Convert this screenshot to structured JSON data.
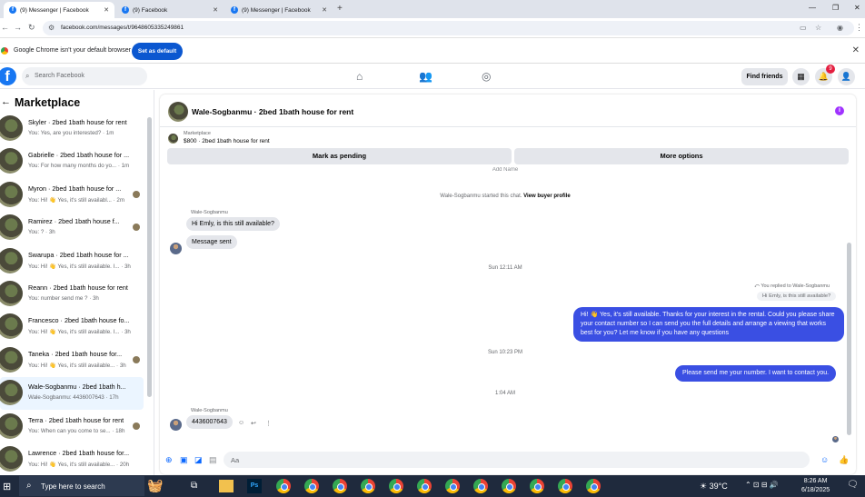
{
  "browser": {
    "tabs": [
      {
        "label": "(9) Messenger | Facebook",
        "active": true
      },
      {
        "label": "(9) Facebook",
        "active": false
      },
      {
        "label": "(9) Messenger | Facebook",
        "active": false
      }
    ],
    "url": "facebook.com/messages/t/9648605335249861",
    "default_msg": "Google Chrome isn't your default browser",
    "set_default_label": "Set as default"
  },
  "fb_header": {
    "search_placeholder": "Search Facebook",
    "find_friends_label": "Find friends",
    "notif_count": "9"
  },
  "sidebar": {
    "title": "Marketplace",
    "conversations": [
      {
        "name": "Skyler · 2bed 1bath house for rent",
        "preview": "You: Yes, are you interested? · 1m",
        "selected": false,
        "dot": false
      },
      {
        "name": "Gabrielle · 2bed 1bath house for ...",
        "preview": "You: For how many months do yo... · 1m",
        "selected": false,
        "dot": false
      },
      {
        "name": "Myron · 2bed 1bath house for ...",
        "preview": "You: Hi! 👋 Yes, it's still availabl... · 2m",
        "selected": false,
        "dot": true
      },
      {
        "name": "Ramirez · 2bed 1bath house f...",
        "preview": "You: ? · 3h",
        "selected": false,
        "dot": true
      },
      {
        "name": "Swarupa · 2bed 1bath house for ...",
        "preview": "You: Hi! 👋 Yes, it's still available. I... · 3h",
        "selected": false,
        "dot": false
      },
      {
        "name": "Reann · 2bed 1bath house for rent",
        "preview": "You: number send me ? · 3h",
        "selected": false,
        "dot": false
      },
      {
        "name": "Francesco · 2bed 1bath house fo...",
        "preview": "You: Hi! 👋 Yes, it's still available. I... · 3h",
        "selected": false,
        "dot": false
      },
      {
        "name": "Taneka · 2bed 1bath house for...",
        "preview": "You: Hi! 👋 Yes, it's still available... · 3h",
        "selected": false,
        "dot": true
      },
      {
        "name": "Wale-Sogbanmu · 2bed 1bath h...",
        "preview": "Wale-Sogbanmu: 4436007643 · 17h",
        "selected": true,
        "dot": false
      },
      {
        "name": "Terra · 2bed 1bath house for rent",
        "preview": "You: When can you come to se... · 18h",
        "selected": false,
        "dot": true
      },
      {
        "name": "Lawrence · 2bed 1bath house for...",
        "preview": "You: Hi! 👋 Yes, it's still available... · 20h",
        "selected": false,
        "dot": false
      }
    ]
  },
  "chat": {
    "title": "Wale-Sogbanmu · 2bed 1bath house for rent",
    "marketplace_label": "Marketplace",
    "listing": "$800 · 2bed 1bath house for rent",
    "mark_pending_label": "Mark as pending",
    "more_options_label": "More options",
    "truncated_top": "Add        Name",
    "started_text": "Wale-Sogbanmu started this chat.",
    "view_profile_label": "View buyer profile",
    "sender_name_1": "Wale-Sogbanmu",
    "msg_in_1": "Hi Emly, is this still available?",
    "msg_in_2": "Message sent",
    "time_1": "Sun 12:11 AM",
    "replied_label": "You replied to Wale-Sogbanmu",
    "replied_quote": "Hi Emly, is this still available?",
    "msg_out_1": "Hi! 👋 Yes, it's still available. Thanks for your interest in the rental. Could you please share your contact number so I can send you the full details and arrange a viewing that works best for you? Let me know if you have any questions",
    "time_2": "Sun 10:23 PM",
    "msg_out_2": "Please send me your number. I want to contact you.",
    "time_3": "1:04 AM",
    "sender_name_2": "Wale-Sogbanmu",
    "msg_in_3": "4436007643",
    "composer_placeholder": "Aa"
  },
  "taskbar": {
    "search_placeholder": "Type here to search",
    "temperature": "39°C",
    "time": "8:26 AM",
    "date": "6/18/2025"
  }
}
